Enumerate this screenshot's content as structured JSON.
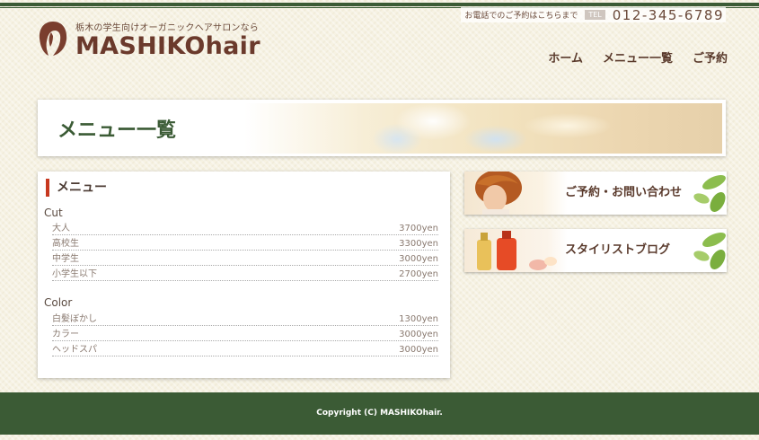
{
  "header": {
    "tagline": "栃木の学生向けオーガニックヘアサロンなら",
    "site_title": "MASHIKOhair",
    "contact_note": "お電話でのご予約はこちらまで",
    "tel_badge": "TEL",
    "tel_number": "012-345-6789",
    "logo_icon": "woman-silhouette-icon"
  },
  "nav": {
    "items": [
      {
        "label": "ホーム"
      },
      {
        "label": "メニュー一覧"
      },
      {
        "label": "ご予約"
      }
    ]
  },
  "banner": {
    "title": "メニュー一覧"
  },
  "menu": {
    "heading": "メニュー",
    "categories": [
      {
        "title": "Cut",
        "items": [
          {
            "name": "大人",
            "price": "3700yen"
          },
          {
            "name": "高校生",
            "price": "3300yen"
          },
          {
            "name": "中学生",
            "price": "3000yen"
          },
          {
            "name": "小学生以下",
            "price": "2700yen"
          }
        ]
      },
      {
        "title": "Color",
        "items": [
          {
            "name": "白髪ぼかし",
            "price": "1300yen"
          },
          {
            "name": "カラー",
            "price": "3000yen"
          },
          {
            "name": "ヘッドスパ",
            "price": "3000yen"
          }
        ]
      }
    ]
  },
  "side_banners": [
    {
      "label": "ご予約・お問い合わせ"
    },
    {
      "label": "スタイリストブログ"
    }
  ],
  "footer": {
    "copyright": "Copyright (C) MASHIKOhair."
  },
  "colors": {
    "accent_green": "#3b5b35",
    "brand_brown": "#6b3a2c",
    "heading_red": "#c7381f"
  }
}
